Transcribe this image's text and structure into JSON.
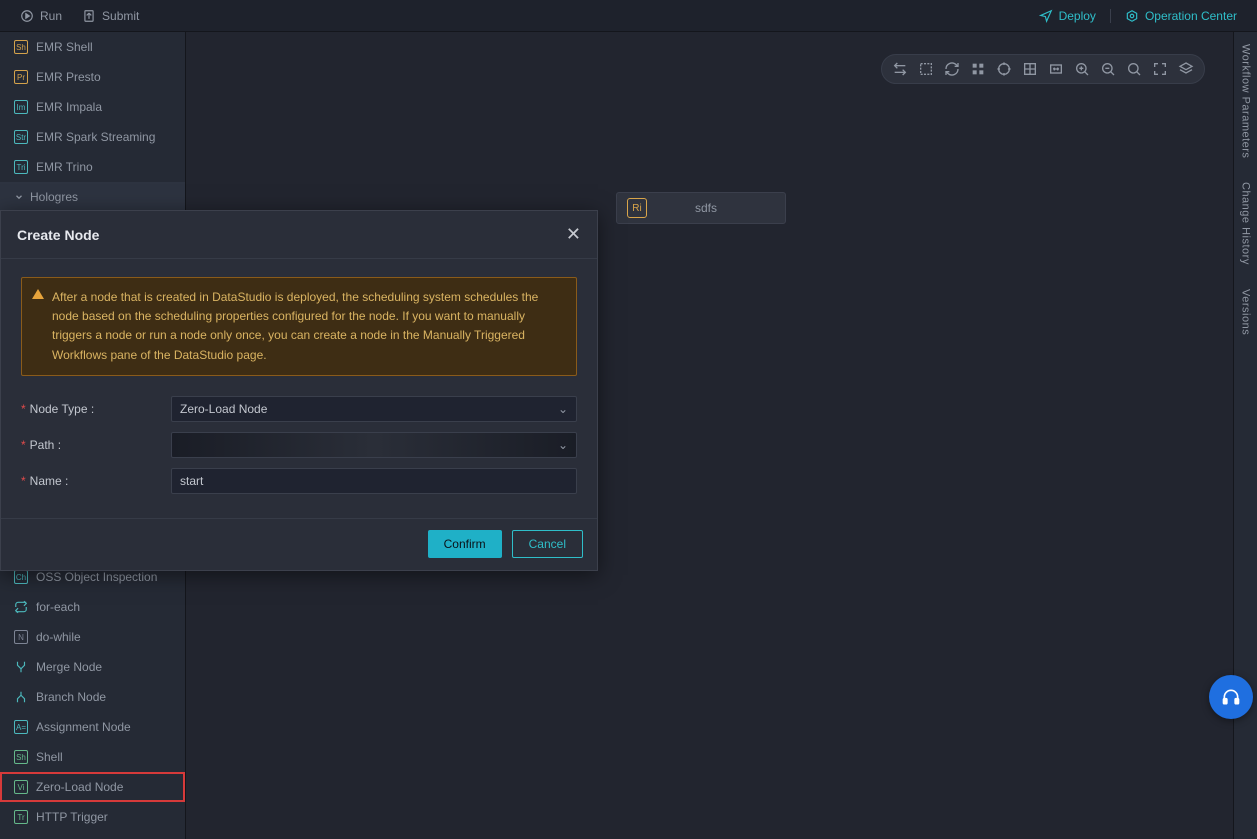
{
  "topbar": {
    "run": "Run",
    "submit": "Submit",
    "deploy": "Deploy",
    "opcenter": "Operation Center"
  },
  "sidebar": {
    "items": [
      {
        "abbr": "Sh",
        "cls": "orange",
        "label": "EMR Shell"
      },
      {
        "abbr": "Pr",
        "cls": "orange",
        "label": "EMR Presto"
      },
      {
        "abbr": "Im",
        "cls": "teal",
        "label": "EMR Impala"
      },
      {
        "abbr": "Str",
        "cls": "teal",
        "label": "EMR Spark Streaming"
      },
      {
        "abbr": "Tri",
        "cls": "teal",
        "label": "EMR Trino"
      }
    ],
    "group": "Hologres",
    "items2": [
      {
        "abbr": "Ch",
        "cls": "teal",
        "label": "OSS Object Inspection",
        "icon": "box"
      },
      {
        "label": "for-each",
        "icon": "loop"
      },
      {
        "abbr": "N",
        "cls": "grey",
        "label": "do-while",
        "icon": "box"
      },
      {
        "label": "Merge Node",
        "icon": "merge"
      },
      {
        "label": "Branch Node",
        "icon": "branch"
      },
      {
        "abbr": "A=",
        "cls": "teal",
        "label": "Assignment Node",
        "icon": "box"
      },
      {
        "abbr": "Sh",
        "cls": "green",
        "label": "Shell",
        "icon": "box"
      },
      {
        "abbr": "Vi",
        "cls": "green",
        "label": "Zero-Load Node",
        "icon": "box",
        "hl": true
      },
      {
        "abbr": "Tr",
        "cls": "green",
        "label": "HTTP Trigger",
        "icon": "box"
      }
    ]
  },
  "rail": {
    "tabs": [
      "Workflow Parameters",
      "Change History",
      "Versions"
    ]
  },
  "canvas": {
    "node": {
      "abbr": "Ri",
      "label": "sdfs"
    }
  },
  "modal": {
    "title": "Create Node",
    "alert": "After a node that is created in DataStudio is deployed, the scheduling system schedules the node based on the scheduling properties configured for the node. If you want to manually triggers a node or run a node only once, you can create a node in the Manually Triggered Workflows pane of the DataStudio page.",
    "node_type_label": "Node Type :",
    "node_type_value": "Zero-Load Node",
    "path_label": "Path :",
    "path_value": "",
    "name_label": "Name :",
    "name_value": "start",
    "confirm": "Confirm",
    "cancel": "Cancel"
  }
}
